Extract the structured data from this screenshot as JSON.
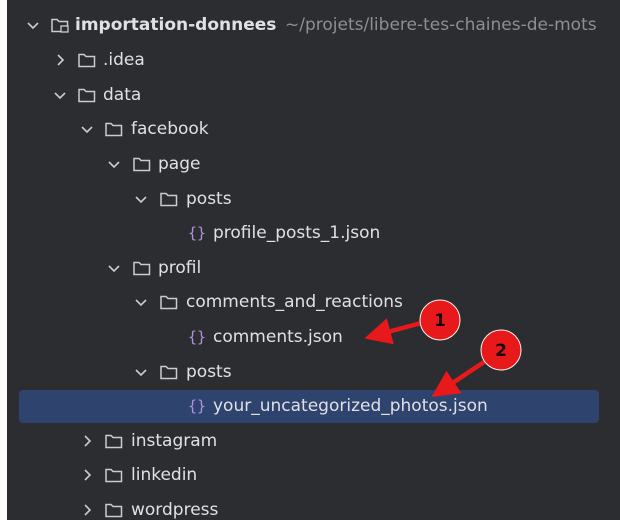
{
  "root": {
    "name": "importation-donnees",
    "path_hint": "~/projets/libere-tes-chaines-de-mots"
  },
  "tree": [
    {
      "label": ".idea",
      "type": "folder",
      "expanded": false,
      "depth": 1
    },
    {
      "label": "data",
      "type": "folder",
      "expanded": true,
      "depth": 1
    },
    {
      "label": "facebook",
      "type": "folder",
      "expanded": true,
      "depth": 2
    },
    {
      "label": "page",
      "type": "folder",
      "expanded": true,
      "depth": 3
    },
    {
      "label": "posts",
      "type": "folder",
      "expanded": true,
      "depth": 4
    },
    {
      "label": "profile_posts_1.json",
      "type": "json",
      "depth": 5
    },
    {
      "label": "profil",
      "type": "folder",
      "expanded": true,
      "depth": 3
    },
    {
      "label": "comments_and_reactions",
      "type": "folder",
      "expanded": true,
      "depth": 4
    },
    {
      "label": "comments.json",
      "type": "json",
      "depth": 5
    },
    {
      "label": "posts",
      "type": "folder",
      "expanded": true,
      "depth": 4
    },
    {
      "label": "your_uncategorized_photos.json",
      "type": "json",
      "depth": 5,
      "selected": true
    },
    {
      "label": "instagram",
      "type": "folder",
      "expanded": false,
      "depth": 2
    },
    {
      "label": "linkedin",
      "type": "folder",
      "expanded": false,
      "depth": 2
    },
    {
      "label": "wordpress",
      "type": "folder",
      "expanded": false,
      "depth": 2
    }
  ],
  "annotations": [
    {
      "number": "1",
      "target": "comments.json"
    },
    {
      "number": "2",
      "target": "your_uncategorized_photos.json"
    }
  ],
  "colors": {
    "background": "#2b2d30",
    "text": "#dfe1e5",
    "path_hint": "#8c8f94",
    "selection": "#2e436e",
    "json_icon": "#b58fe0",
    "annotation": "#e8191a"
  },
  "icons": {
    "chevron_expanded": "chevron-down-icon",
    "chevron_collapsed": "chevron-right-icon",
    "folder": "folder-icon",
    "json": "json-file-icon"
  }
}
